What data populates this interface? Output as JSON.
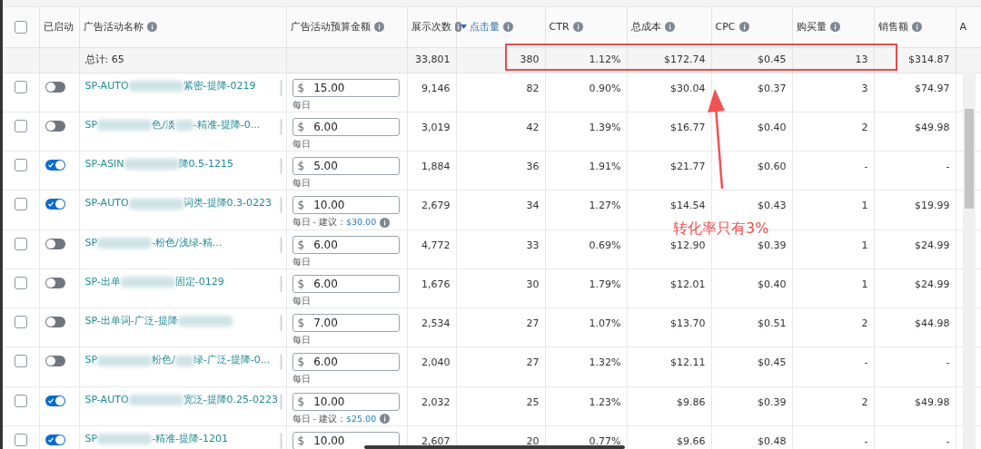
{
  "columns": [
    {
      "kind": "checkbox",
      "checked": false
    },
    {
      "label": "已启动",
      "kind": "text",
      "info": false,
      "sorted": false
    },
    {
      "label": "广告活动名称",
      "kind": "text",
      "info": true,
      "sorted": false
    },
    {
      "label": "广告活动预算金额",
      "kind": "text",
      "info": true,
      "sorted": false
    },
    {
      "label": "展示次数",
      "kind": "text",
      "info": true,
      "sorted": false
    },
    {
      "label": "点击量",
      "kind": "text",
      "info": true,
      "sorted": true
    },
    {
      "label": "CTR",
      "kind": "text",
      "info": true,
      "sorted": false
    },
    {
      "label": "总成本",
      "kind": "text",
      "info": true,
      "sorted": false
    },
    {
      "label": "CPC",
      "kind": "text",
      "info": true,
      "sorted": false
    },
    {
      "label": "购买量",
      "kind": "text",
      "info": true,
      "sorted": false
    },
    {
      "label": "销售额",
      "kind": "text",
      "info": true,
      "sorted": false
    },
    {
      "label": "A",
      "kind": "text",
      "info": false,
      "sorted": false
    }
  ],
  "total": {
    "label": "总计: 65",
    "values": [
      "33,801",
      "380",
      "1.12%",
      "$172.74",
      "$0.45",
      "13",
      "$314.87"
    ]
  },
  "rows": [
    {
      "checked": false,
      "enabled": false,
      "name_start": "SP-AUTO",
      "name_end": "紧密-提降-0219",
      "currency": "$",
      "budget": "15.00",
      "period": "每日",
      "values": [
        "9,146",
        "82",
        "0.90%",
        "$30.04",
        "$0.37",
        "3",
        "$74.97"
      ]
    },
    {
      "checked": false,
      "enabled": false,
      "name_start": "SP",
      "name_end": "色/淡",
      "name_end2": "-精准-提降-0...",
      "currency": "$",
      "budget": "6.00",
      "period": "每日",
      "values": [
        "3,019",
        "42",
        "1.39%",
        "$16.77",
        "$0.40",
        "2",
        "$49.98"
      ]
    },
    {
      "checked": false,
      "enabled": true,
      "name_start": "SP-ASIN",
      "name_end": "降0.5-1215",
      "currency": "$",
      "budget": "5.00",
      "period": "每日",
      "values": [
        "1,884",
        "36",
        "1.91%",
        "$21.77",
        "$0.60",
        "-",
        "-"
      ]
    },
    {
      "checked": false,
      "enabled": true,
      "name_start": "SP-AUTO",
      "name_end": "词类-提降0.3-0223",
      "currency": "$",
      "budget": "10.00",
      "period": "每日 - 建议：",
      "suggestion": "$30.00",
      "values": [
        "2,679",
        "34",
        "1.27%",
        "$14.54",
        "$0.43",
        "1",
        "$19.99"
      ]
    },
    {
      "checked": false,
      "enabled": false,
      "name_start": "SP",
      "name_end": "-粉色/浅绿-精...",
      "currency": "$",
      "budget": "6.00",
      "period": "每日",
      "values": [
        "4,772",
        "33",
        "0.69%",
        "$12.90",
        "$0.39",
        "1",
        "$24.99"
      ]
    },
    {
      "checked": false,
      "enabled": false,
      "name_start": "SP-出单",
      "name_end": "固定-0129",
      "currency": "$",
      "budget": "6.00",
      "period": "每日",
      "values": [
        "1,676",
        "30",
        "1.79%",
        "$12.01",
        "$0.40",
        "1",
        "$24.99"
      ]
    },
    {
      "checked": false,
      "enabled": false,
      "name_start": "SP-出单词-广泛-提降",
      "name_end": "",
      "currency": "$",
      "budget": "7.00",
      "period": "每日",
      "values": [
        "2,534",
        "27",
        "1.07%",
        "$13.70",
        "$0.51",
        "2",
        "$44.98"
      ]
    },
    {
      "checked": false,
      "enabled": false,
      "name_start": "SP",
      "name_end": "粉色/",
      "name_end2": "绿-广泛-提降-0...",
      "currency": "$",
      "budget": "6.00",
      "period": "每日",
      "values": [
        "2,040",
        "27",
        "1.32%",
        "$12.11",
        "$0.45",
        "-",
        "-"
      ]
    },
    {
      "checked": false,
      "enabled": true,
      "name_start": "SP-AUTO",
      "name_end": "宽泛-提降0.25-0223",
      "currency": "$",
      "budget": "10.00",
      "period": "每日 - 建议：",
      "suggestion": "$25.00",
      "values": [
        "2,032",
        "25",
        "1.23%",
        "$9.86",
        "$0.39",
        "2",
        "$49.98"
      ]
    },
    {
      "checked": false,
      "enabled": true,
      "name_start": "SP",
      "name_end": "-精准-提降-1201",
      "currency": "$",
      "budget": "10.00",
      "values": [
        "2,607",
        "20",
        "0.77%",
        "$9.66",
        "$0.48",
        "-",
        "-"
      ]
    }
  ],
  "annotation": {
    "text": "转化率只有3%"
  }
}
